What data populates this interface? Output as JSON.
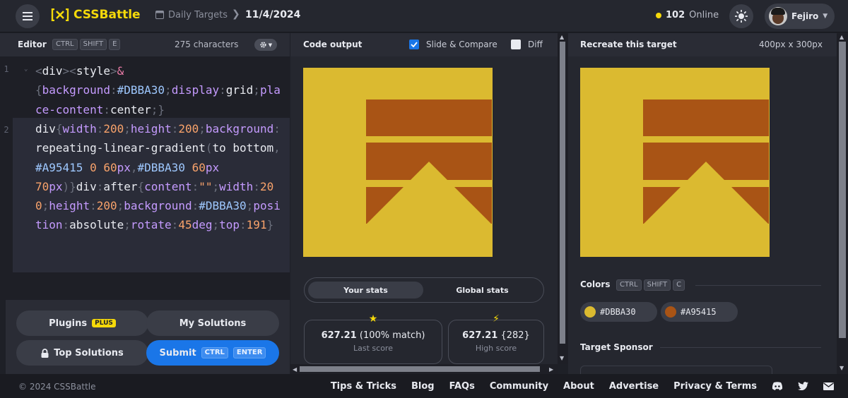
{
  "header": {
    "logo_text": "CSSBattle",
    "breadcrumb_section": "Daily Targets",
    "breadcrumb_date": "11/4/2024",
    "online_count": "102",
    "online_label": "Online",
    "user_name": "Fejiro"
  },
  "editor": {
    "title": "Editor",
    "shortcut": [
      "CTRL",
      "SHIFT",
      "E"
    ],
    "char_count": "275 characters",
    "line_numbers": [
      "1",
      "2"
    ],
    "code": {
      "l1a": "<div><style>&",
      "l1b": "{background:#DBBA30;display:grid;place-content:center;}",
      "l2": "div{width:200;height:200;background:repeating-linear-gradient(to bottom,#A95415 0 60px,#DBBA30 60px 70px)}div:after{content:\"\";width:200;height:200;background:#DBBA30;position:absolute;rotate:45deg;top:191}"
    }
  },
  "buttons": {
    "plugins": "Plugins",
    "plugins_badge": "PLUS",
    "my_solutions": "My Solutions",
    "top_solutions": "Top Solutions",
    "submit": "Submit",
    "submit_shortcut": [
      "CTRL",
      "ENTER"
    ]
  },
  "output": {
    "title": "Code output",
    "slide_compare": "Slide & Compare",
    "slide_compare_checked": true,
    "diff": "Diff",
    "diff_checked": false
  },
  "stats": {
    "tab_your": "Your stats",
    "tab_global": "Global stats",
    "last_score_value": "627.21",
    "last_score_match": "(100% match)",
    "last_score_label": "Last score",
    "high_score_value": "627.21",
    "high_score_rank": "{282}",
    "high_score_label": "High score"
  },
  "target": {
    "title": "Recreate this target",
    "size": "400px x 300px",
    "colors_title": "Colors",
    "colors_shortcut": [
      "CTRL",
      "SHIFT",
      "C"
    ],
    "colors": [
      {
        "hex": "#DBBA30",
        "label": "#DBBA30"
      },
      {
        "hex": "#A95415",
        "label": "#A95415"
      }
    ],
    "sponsor_title": "Target Sponsor"
  },
  "art_colors": {
    "background": "#DBBA30",
    "stripe": "#A95415"
  },
  "footer": {
    "copyright": "© 2024 CSSBattle",
    "links": [
      "Tips & Tricks",
      "Blog",
      "FAQs",
      "Community",
      "About",
      "Advertise",
      "Privacy & Terms"
    ],
    "social_icons": [
      "discord-icon",
      "twitter-icon",
      "mail-icon"
    ]
  }
}
